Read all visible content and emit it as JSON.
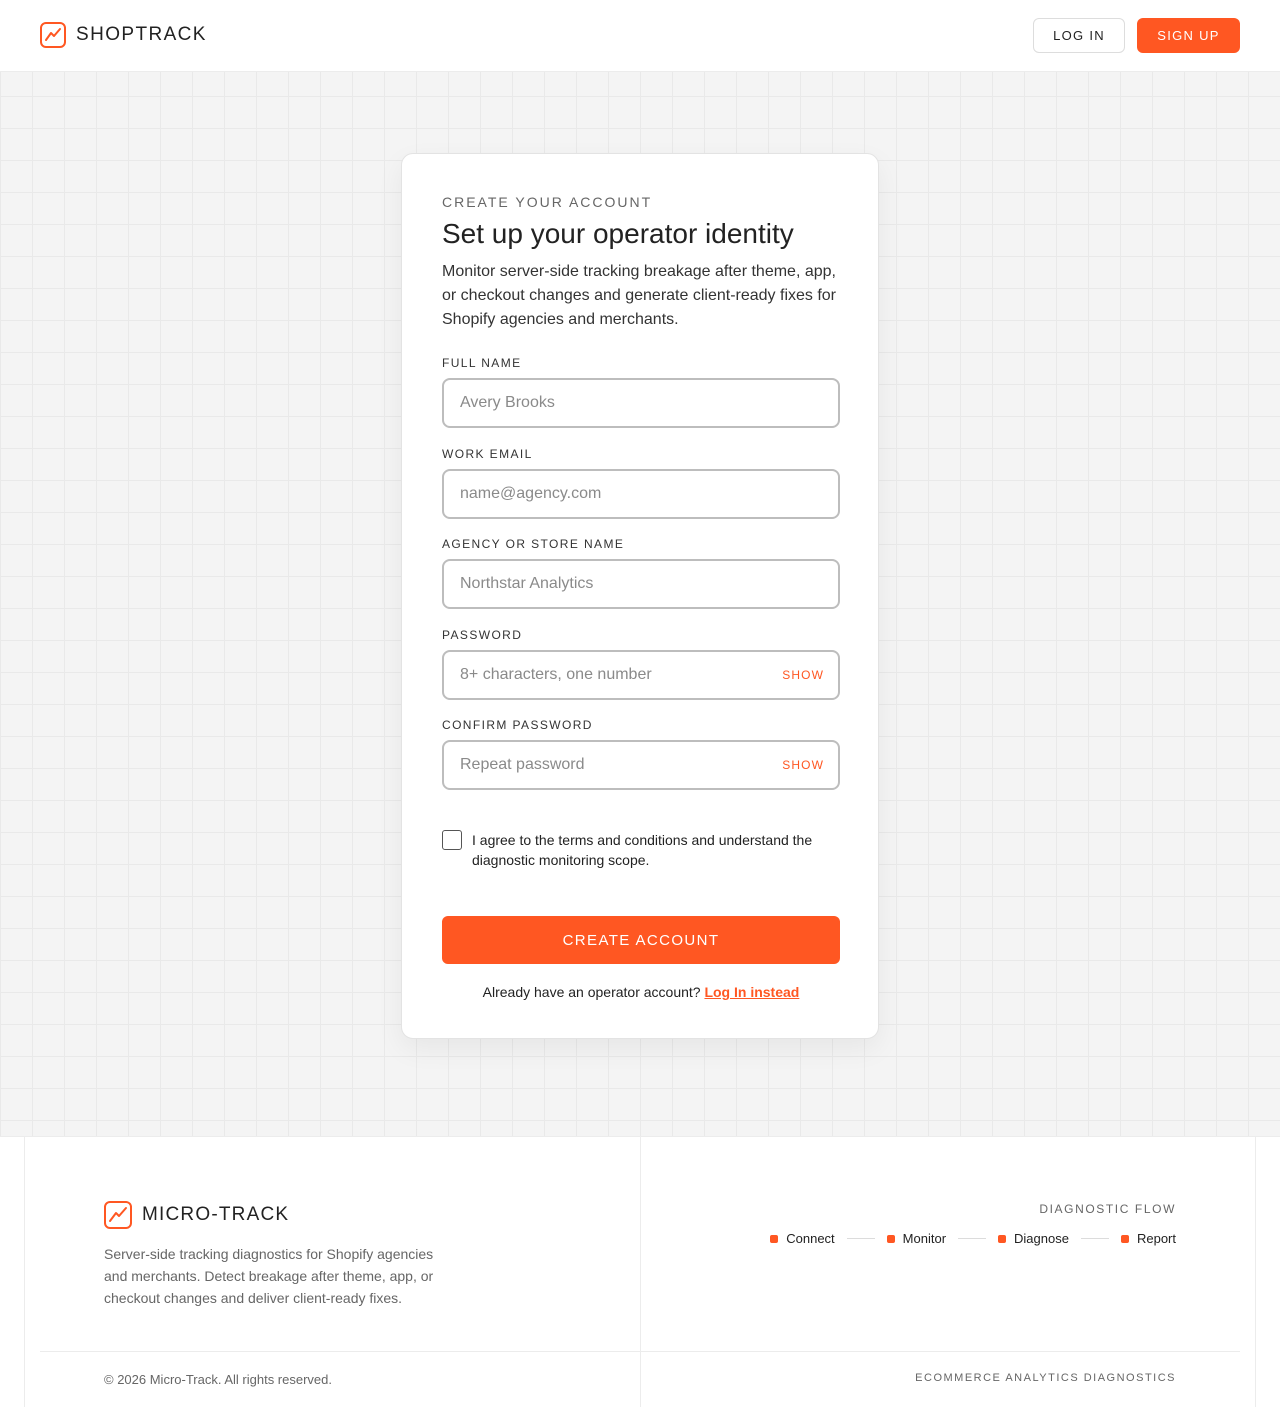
{
  "header": {
    "brand": "SHOPTRACK",
    "login_label": "LOG IN",
    "signup_label": "SIGN UP"
  },
  "card": {
    "eyebrow": "CREATE YOUR ACCOUNT",
    "title": "Set up your operator identity",
    "description": "Monitor server-side tracking breakage after theme, app, or checkout changes and generate client-ready fixes for Shopify agencies and merchants.",
    "fields": {
      "full_name": {
        "label": "FULL NAME",
        "placeholder": "Avery Brooks"
      },
      "work_email": {
        "label": "WORK EMAIL",
        "placeholder": "name@agency.com"
      },
      "agency": {
        "label": "AGENCY OR STORE NAME",
        "placeholder": "Northstar Analytics"
      },
      "password": {
        "label": "PASSWORD",
        "placeholder": "8+ characters, one number",
        "toggle": "SHOW"
      },
      "confirm_password": {
        "label": "CONFIRM PASSWORD",
        "placeholder": "Repeat password",
        "toggle": "SHOW"
      }
    },
    "agree_text": "I agree to the terms and conditions and understand the diagnostic monitoring scope.",
    "submit_label": "CREATE ACCOUNT",
    "already_text": "Already have an operator account? ",
    "login_link": "Log In instead"
  },
  "footer": {
    "brand": "MICRO-TRACK",
    "description": "Server-side tracking diagnostics for Shopify agencies and merchants. Detect breakage after theme, app, or checkout changes and deliver client-ready fixes.",
    "flow_label": "DIAGNOSTIC FLOW",
    "flow_steps": [
      "Connect",
      "Monitor",
      "Diagnose",
      "Report"
    ],
    "copyright": "© 2026 Micro-Track. All rights reserved.",
    "tagline": "ECOMMERCE ANALYTICS DIAGNOSTICS"
  },
  "colors": {
    "accent": "#ff5722",
    "grid_background": "#f4f4f4"
  },
  "icons": {
    "brand_logo": "trend-chart-icon",
    "flow_marker": "square-dot-icon"
  }
}
